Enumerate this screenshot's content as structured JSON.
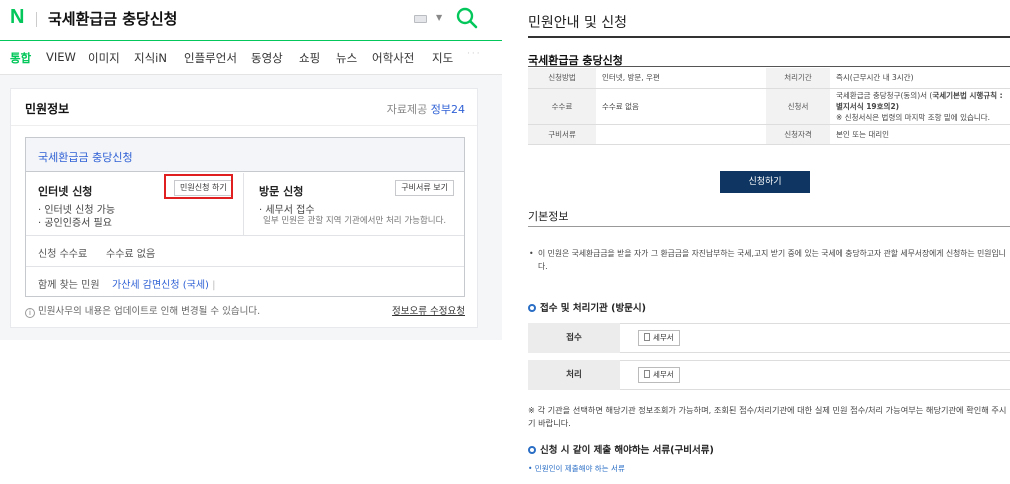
{
  "header": {
    "logo": "N",
    "query": "국세환급금 충당신청"
  },
  "tabs": [
    "통합",
    "VIEW",
    "이미지",
    "지식iN",
    "인플루언서",
    "동영상",
    "쇼핑",
    "뉴스",
    "어학사전",
    "지도"
  ],
  "more_label": "···",
  "card": {
    "title": "민원정보",
    "provider_prefix": "자료제공",
    "provider_name": "정부24",
    "service_name": "국세환급금 충당신청",
    "internet": {
      "title": "인터넷 신청",
      "button": "민원신청 하기",
      "line1": "· 인터넷 신청 가능",
      "line2": "· 공인인증서 필요"
    },
    "visit": {
      "title": "방문 신청",
      "button": "구비서류 보기",
      "line1": "· 세무서 접수",
      "line2": "일부 민원은 관할 지역 기관에서만 처리 가능합니다."
    },
    "fee_label": "신청 수수료",
    "fee_value": "수수료 없음",
    "related_label": "함께 찾는 민원",
    "related_link": "가산세 감면신청 (국세)",
    "related_sep": "|",
    "notice": "민원사무의 내용은 업데이트로 인해 변경될 수 있습니다.",
    "report_link": "정보오류 수정요청"
  },
  "right": {
    "title": "민원안내 및 신청",
    "subtitle": "국세환급금 충당신청",
    "table": [
      {
        "k1": "신청방법",
        "v1": "인터넷, 방문, 우편",
        "k2": "처리기간",
        "v2": "즉시(근무시간 내 3시간)"
      },
      {
        "k1": "수수료",
        "v1": "수수료 없음",
        "k2": "신청서",
        "v2a": "국세환급금 충당청구(동의)서 (",
        "v2b": "국세기본법 시행규칙 : 별지서식 19호의2)",
        "v2note": "※ 신청서식은 법령의 마지막 조항 밑에 있습니다."
      },
      {
        "k1": "구비서류",
        "v1": "",
        "k2": "신청자격",
        "v2": "본인 또는 대리인"
      }
    ],
    "apply_button": "신청하기",
    "basic_title": "기본정보",
    "basic_text": "이 민원은 국세환급금을 받을 자가 그 환급금을 자진납부하는 국세,고지 받기 중에 있는 국세에 충당하고자 관할 세무서장에게 신청하는 민원입니다.",
    "section1": "접수 및 처리기관 (방문시)",
    "receive_label": "접수",
    "process_label": "처리",
    "office": "세무서",
    "note": "※ 각 기관을 선택하면 해당기관 정보조회가 가능하며, 조회된 접수/처리기관에 대한 실제 민원 접수/처리 가능여부는 해당기관에 확인해 주시기 바랍니다.",
    "section2": "신청 시 같이 제출 해야하는 서류(구비서류)",
    "doc_link": "• 민원인이 제출해야 하는 서류"
  },
  "colors": {
    "brand_green": "#03c75a",
    "link_blue": "#2f61d5",
    "highlight_red": "#e02020",
    "navy_button": "#0f3662"
  }
}
